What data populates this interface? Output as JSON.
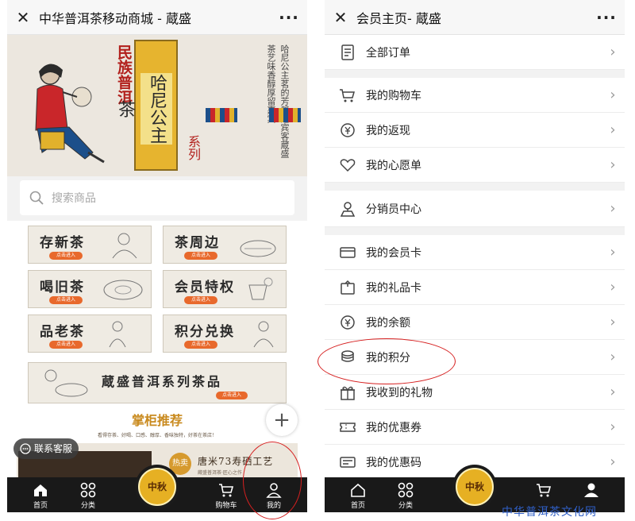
{
  "left": {
    "title": "中华普洱茶移动商城 - 蔵盛",
    "close_icon": "close-icon",
    "more_label": "···",
    "banner": {
      "red_text": "民族普洱",
      "gold_text": "哈尼公主茶",
      "series_text": "系列",
      "poem": "哈尼公主茗的芳馨迎宾客蔵盛茶艺味香醇厚留嘉宾"
    },
    "search_placeholder": "搜索商品",
    "tiles": [
      {
        "label": "存新茶",
        "tag": "点击进入"
      },
      {
        "label": "茶周边",
        "tag": "点击进入"
      },
      {
        "label": "喝旧茶",
        "tag": "点击进入"
      },
      {
        "label": "会员特权",
        "tag": "点击进入"
      },
      {
        "label": "品老茶",
        "tag": "点击进入"
      },
      {
        "label": "积分兑换",
        "tag": "点击进入"
      }
    ],
    "wide_tile": {
      "label": "蔵盛普洱系列茶品",
      "tag": "点击进入"
    },
    "recommend": {
      "title": "掌柜推荐",
      "subtitle": "看得存茶、好喝、口感、醇厚、香味独特，好茶在茶店！"
    },
    "plus_label": "+",
    "promo": {
      "badge": "热卖",
      "text": "唐米73寿硒工艺",
      "small": "蔵盛普洱茶·匠心之作"
    },
    "service_label": "联系客服",
    "tabs": [
      {
        "label": "首页",
        "icon": "home-icon"
      },
      {
        "label": "分类",
        "icon": "category-icon"
      },
      {
        "label": "购物车",
        "icon": "cart-icon"
      },
      {
        "label": "我的",
        "icon": "user-icon"
      }
    ],
    "center_badge": "中秋"
  },
  "right": {
    "title": "会员主页- 蔵盛",
    "more_label": "···",
    "groups": [
      [
        {
          "label": "全部订单",
          "icon": "order-icon"
        }
      ],
      [
        {
          "label": "我的购物车",
          "icon": "cart-icon"
        },
        {
          "label": "我的返现",
          "icon": "cashback-icon"
        },
        {
          "label": "我的心愿单",
          "icon": "heart-icon"
        }
      ],
      [
        {
          "label": "分销员中心",
          "icon": "distributor-icon"
        }
      ],
      [
        {
          "label": "我的会员卡",
          "icon": "member-card-icon"
        },
        {
          "label": "我的礼品卡",
          "icon": "gift-card-icon"
        },
        {
          "label": "我的余额",
          "icon": "balance-icon"
        },
        {
          "label": "我的积分",
          "icon": "points-icon"
        },
        {
          "label": "我收到的礼物",
          "icon": "gift-icon"
        },
        {
          "label": "我的优惠券",
          "icon": "coupon-icon"
        },
        {
          "label": "我的优惠码",
          "icon": "code-icon"
        }
      ]
    ],
    "tabs": [
      {
        "label": "首页",
        "icon": "home-icon"
      },
      {
        "label": "分类",
        "icon": "category-icon"
      },
      {
        "label": "",
        "icon": "cart-icon"
      },
      {
        "label": "",
        "icon": "user-icon"
      }
    ],
    "center_badge": "中秋"
  },
  "watermark": "中华普洱茶文化网",
  "colors": {
    "accent_red": "#d62020",
    "tab_bar": "#191919",
    "gold": "#e6b023"
  }
}
